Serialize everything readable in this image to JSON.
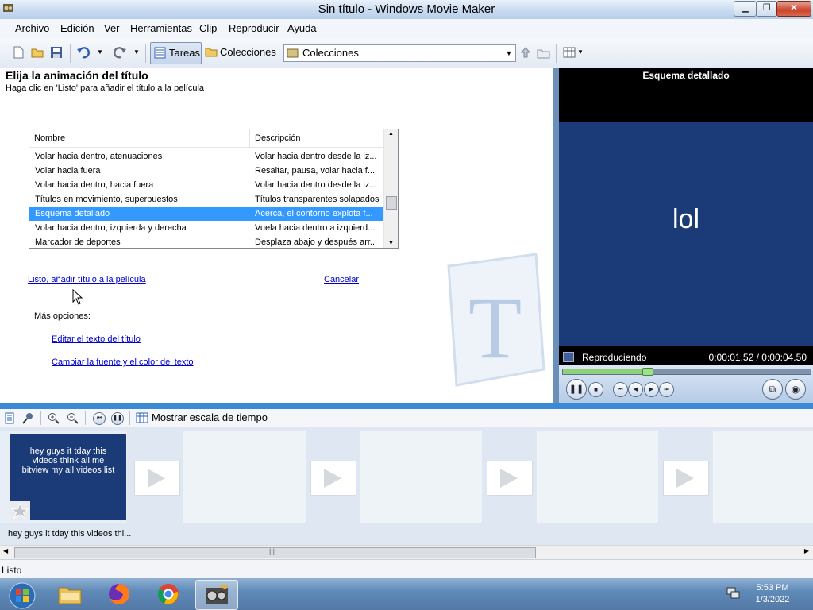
{
  "window": {
    "title": "Sin título - Windows Movie Maker",
    "minimize": "▁",
    "restore": "❐",
    "close": "✕"
  },
  "menu": [
    "Archivo",
    "Edición",
    "Ver",
    "Herramientas",
    "Clip",
    "Reproducir",
    "Ayuda"
  ],
  "toolbar": {
    "tasks_label": "Tareas",
    "collections_label": "Colecciones",
    "collections_combo": "Colecciones"
  },
  "task": {
    "heading": "Elija la animación del título",
    "subheading": "Haga clic en 'Listo' para añadir el título a la película",
    "columns": [
      "Nombre",
      "Descripción"
    ],
    "rows": [
      {
        "name": "Volar hacia dentro, atenuaciones",
        "desc": "Volar hacia dentro desde la iz...",
        "selected": false
      },
      {
        "name": "Volar hacia fuera",
        "desc": "Resaltar, pausa, volar hacia f...",
        "selected": false
      },
      {
        "name": "Volar hacia dentro, hacia fuera",
        "desc": "Volar hacia dentro desde la iz...",
        "selected": false
      },
      {
        "name": "Títulos en movimiento, superpuestos",
        "desc": "Títulos transparentes solapados",
        "selected": false
      },
      {
        "name": "Esquema detallado",
        "desc": "Acerca, el contorno explota f...",
        "selected": true
      },
      {
        "name": "Volar hacia dentro, izquierda y derecha",
        "desc": "Vuela hacia dentro a izquierd...",
        "selected": false
      },
      {
        "name": "Marcador de deportes",
        "desc": "Desplaza abajo y después arr...",
        "selected": false
      }
    ],
    "done_link": "Listo, añadir título a la película",
    "cancel_link": "Cancelar",
    "more_options": "Más opciones:",
    "edit_text_link": "Editar el texto del título",
    "change_font_link": "Cambiar la fuente y el color del texto"
  },
  "preview": {
    "title": "Esquema detallado",
    "video_text": "lol",
    "status": "Reproduciendo",
    "time": "0:00:01.52 / 0:00:04.50",
    "progress": 0.34
  },
  "timeline": {
    "show_timeline": "Mostrar escala de tiempo"
  },
  "storyboard": {
    "clip_text": "hey guys it tday this videos think all me bitview my all videos list",
    "clip_caption": "hey guys it tday this videos thi..."
  },
  "status": {
    "text": "Listo"
  },
  "clock": {
    "time": "5:53 PM",
    "date": "1/3/2022"
  },
  "colors": {
    "selection": "#3399ff",
    "splitter": "#3a8ad6",
    "clip_bg": "#1b3a78"
  }
}
